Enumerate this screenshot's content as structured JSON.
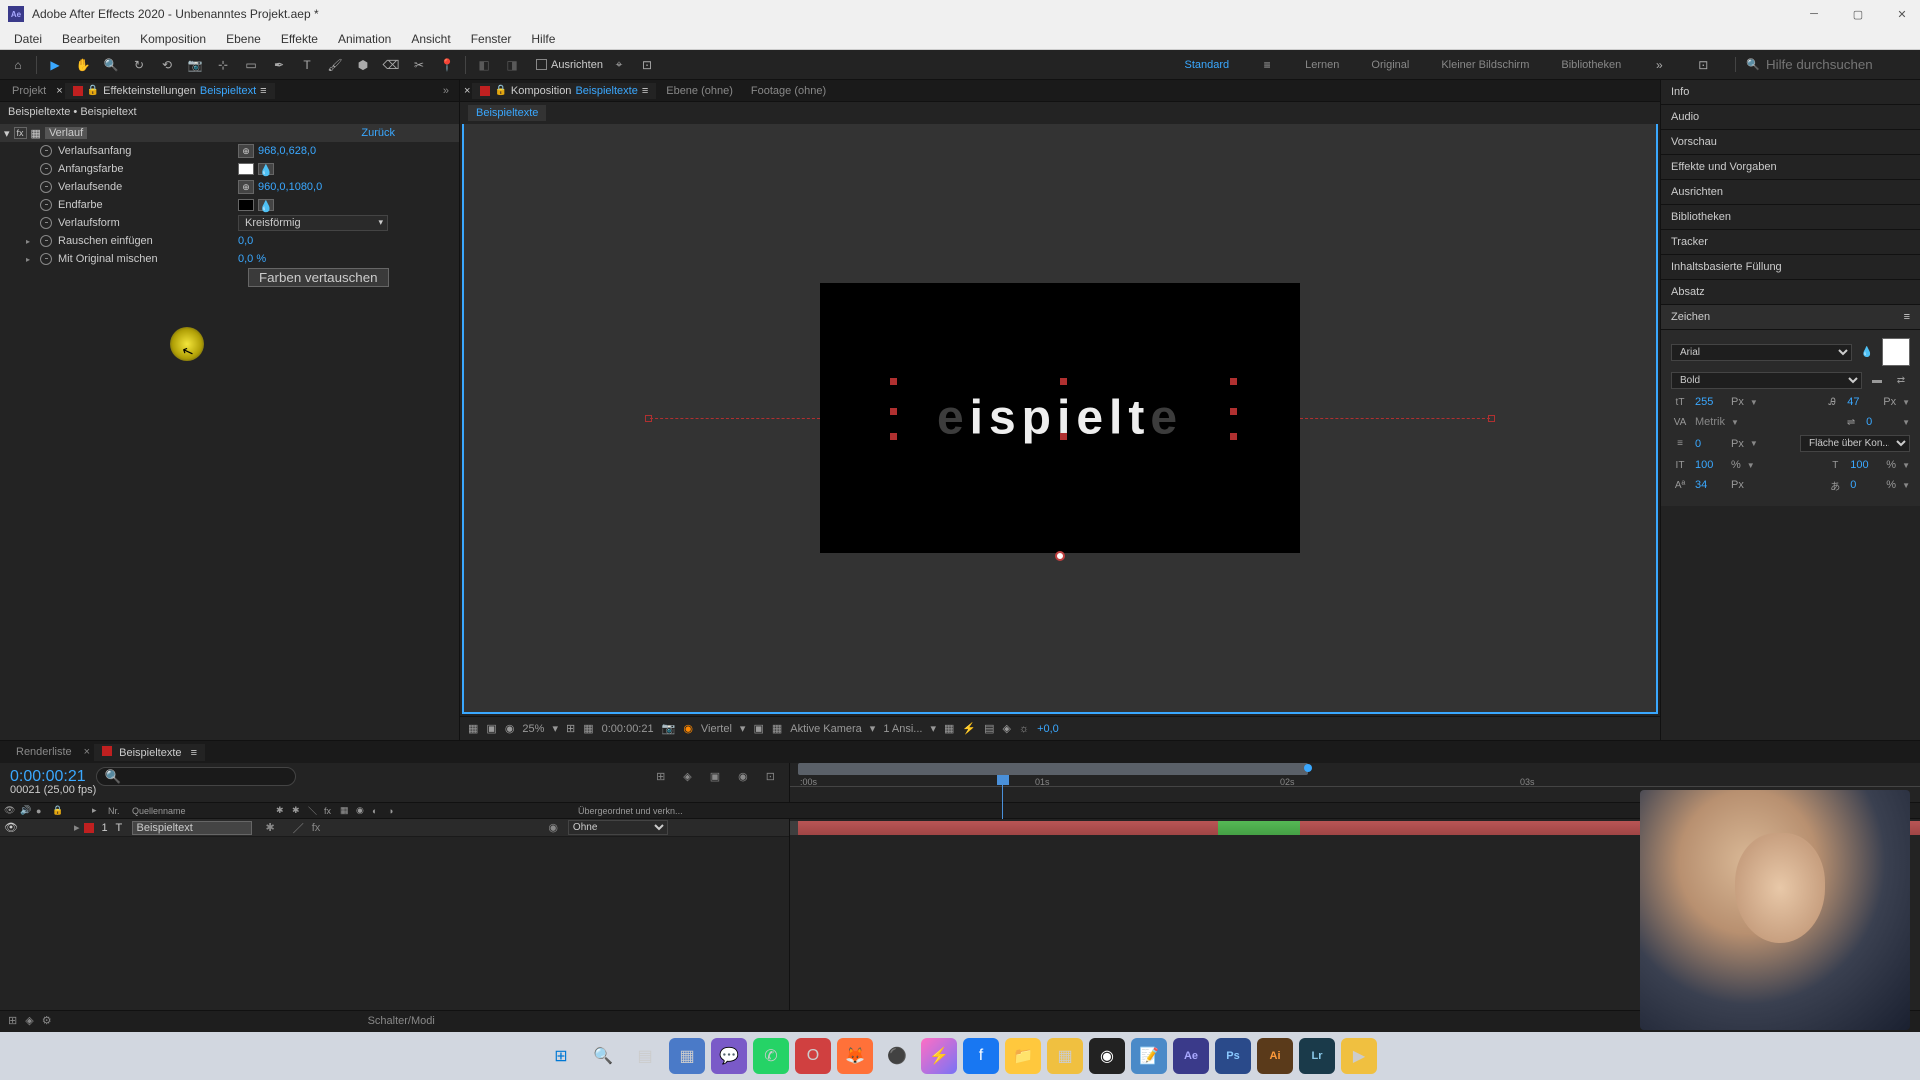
{
  "titlebar": {
    "app_icon_text": "Ae",
    "title": "Adobe After Effects 2020 - Unbenanntes Projekt.aep *"
  },
  "menubar": {
    "items": [
      "Datei",
      "Bearbeiten",
      "Komposition",
      "Ebene",
      "Effekte",
      "Animation",
      "Ansicht",
      "Fenster",
      "Hilfe"
    ]
  },
  "toolbar": {
    "ausrichten": "Ausrichten",
    "workspaces": [
      "Standard",
      "Lernen",
      "Original",
      "Kleiner Bildschirm",
      "Bibliotheken"
    ],
    "search_placeholder": "Hilfe durchsuchen"
  },
  "left_panel": {
    "tab_project": "Projekt",
    "tab_effect_prefix": "Effekteinstellungen",
    "tab_effect_name": "Beispieltext",
    "breadcrumb": "Beispieltexte • Beispieltext",
    "effect": {
      "name": "Verlauf",
      "reset": "Zurück",
      "props": {
        "verlaufsanfang": {
          "label": "Verlaufsanfang",
          "value": "968,0,628,0"
        },
        "anfangsfarbe": {
          "label": "Anfangsfarbe",
          "color": "#ffffff"
        },
        "verlaufsende": {
          "label": "Verlaufsende",
          "value": "960,0,1080,0"
        },
        "endfarbe": {
          "label": "Endfarbe",
          "color": "#000000"
        },
        "verlaufsform": {
          "label": "Verlaufsform",
          "value": "Kreisförmig"
        },
        "rauschen": {
          "label": "Rauschen einfügen",
          "value": "0,0"
        },
        "original": {
          "label": "Mit Original mischen",
          "value": "0,0 %"
        },
        "swap_btn": "Farben vertauschen"
      }
    }
  },
  "center_panel": {
    "tab_comp_prefix": "Komposition",
    "tab_comp_name": "Beispieltexte",
    "tab_ebene": "Ebene  (ohne)",
    "tab_footage": "Footage  (ohne)",
    "subtab": "Beispieltexte",
    "text_display": "ispielt",
    "footer": {
      "zoom": "25%",
      "time": "0:00:00:21",
      "resolution": "Viertel",
      "camera": "Aktive Kamera",
      "views": "1 Ansi...",
      "exposure": "+0,0"
    }
  },
  "right_panel": {
    "sections": [
      "Info",
      "Audio",
      "Vorschau",
      "Effekte und Vorgaben",
      "Ausrichten",
      "Bibliotheken",
      "Tracker",
      "Inhaltsbasierte Füllung",
      "Absatz"
    ],
    "zeichen": {
      "title": "Zeichen",
      "font": "Arial",
      "weight": "Bold",
      "size": "255",
      "size_unit": "Px",
      "leading": "47",
      "leading_unit": "Px",
      "kerning": "Metrik",
      "tracking": "0",
      "stroke": "0",
      "stroke_unit": "Px",
      "fill_label": "Fläche über Kon...",
      "vscale": "100",
      "hscale": "100",
      "percent": "%",
      "baseline": "34",
      "baseline_unit": "Px",
      "tsume": "0"
    }
  },
  "timeline": {
    "tab_render": "Renderliste",
    "tab_comp": "Beispieltexte",
    "timecode": "0:00:00:21",
    "timecode_sub": "00021 (25,00 fps)",
    "col_nr": "Nr.",
    "col_source": "Quellenname",
    "col_parent": "Übergeordnet und verkn...",
    "ruler_ticks": [
      ":00s",
      "01s",
      "02s",
      "03s"
    ],
    "layer": {
      "num": "1",
      "name": "Beispieltext",
      "parent": "Ohne"
    },
    "footer_mode": "Schalter/Modi"
  },
  "taskbar_icons": [
    "windows",
    "search",
    "tasks",
    "widgets",
    "chat",
    "whatsapp",
    "opera",
    "firefox",
    "app1",
    "messenger",
    "facebook",
    "explorer",
    "app2",
    "obs",
    "app3",
    "ae",
    "ps",
    "ai",
    "lr",
    "app4"
  ]
}
